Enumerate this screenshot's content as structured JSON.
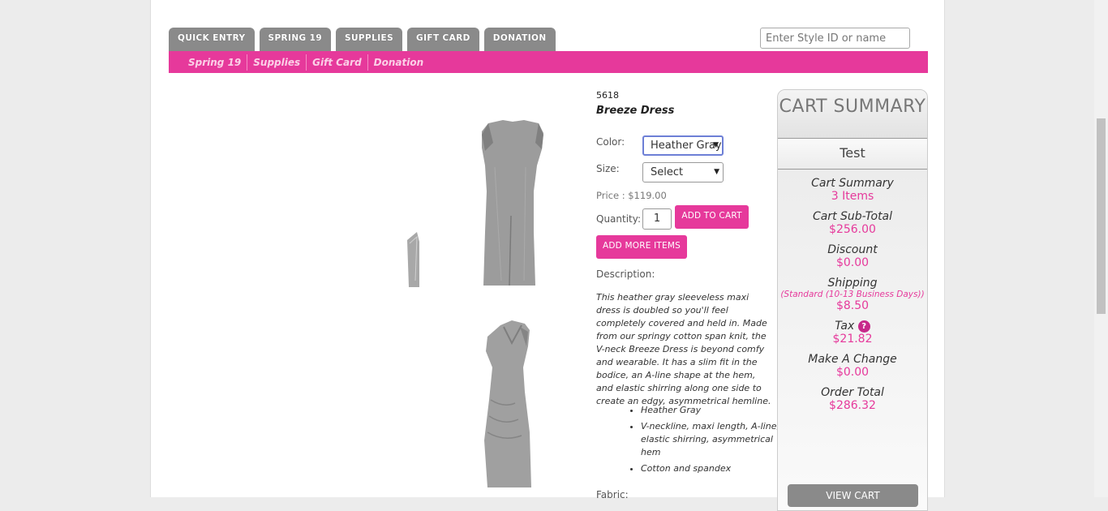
{
  "tabs": [
    {
      "label": "QUICK ENTRY"
    },
    {
      "label": "SPRING 19"
    },
    {
      "label": "SUPPLIES"
    },
    {
      "label": "GIFT CARD"
    },
    {
      "label": "DONATION"
    }
  ],
  "search": {
    "placeholder": "Enter Style ID or name"
  },
  "subnav": [
    {
      "label": "Spring 19"
    },
    {
      "label": "Supplies"
    },
    {
      "label": "Gift Card"
    },
    {
      "label": "Donation"
    }
  ],
  "product": {
    "style_id": "5618",
    "name": "Breeze Dress",
    "color_label": "Color:",
    "color_value": "Heather Gray",
    "size_label": "Size:",
    "size_value": "Select",
    "price": "Price : $119.00",
    "quantity_label": "Quantity:",
    "quantity": "1",
    "add_to_cart": "ADD TO CART",
    "add_more": "ADD MORE ITEMS",
    "description_label": "Description:",
    "description": "This heather gray sleeveless maxi dress is doubled so you'll feel completely covered and held in. Made from our springy cotton span knit, the V-neck Breeze Dress is beyond comfy and wearable. It has a slim fit in the bodice, an A-line shape at the hem, and elastic shirring along one side to create an edgy, asymmetrical hemline.",
    "bullets": [
      "Heather Gray",
      "V-neckline, maxi length, A-line, elastic shirring, asymmetrical hem",
      "Cotton and spandex"
    ],
    "fabric_label": "Fabric:"
  },
  "cart": {
    "title": "CART SUMMARY",
    "user": "Test",
    "summary_label": "Cart Summary",
    "summary_value": "3 Items",
    "subtotal_label": "Cart Sub-Total",
    "subtotal_value": "$256.00",
    "discount_label": "Discount",
    "discount_value": "$0.00",
    "shipping_label": "Shipping",
    "shipping_method": "(Standard (10-13 Business Days))",
    "shipping_value": "$8.50",
    "tax_label": "Tax",
    "tax_help": "?",
    "tax_value": "$21.82",
    "change_label": "Make A Change",
    "change_value": "$0.00",
    "total_label": "Order Total",
    "total_value": "$286.32",
    "view_cart": "VIEW CART"
  },
  "colors": {
    "accent": "#e6399b",
    "tab": "#8a8a8a"
  }
}
